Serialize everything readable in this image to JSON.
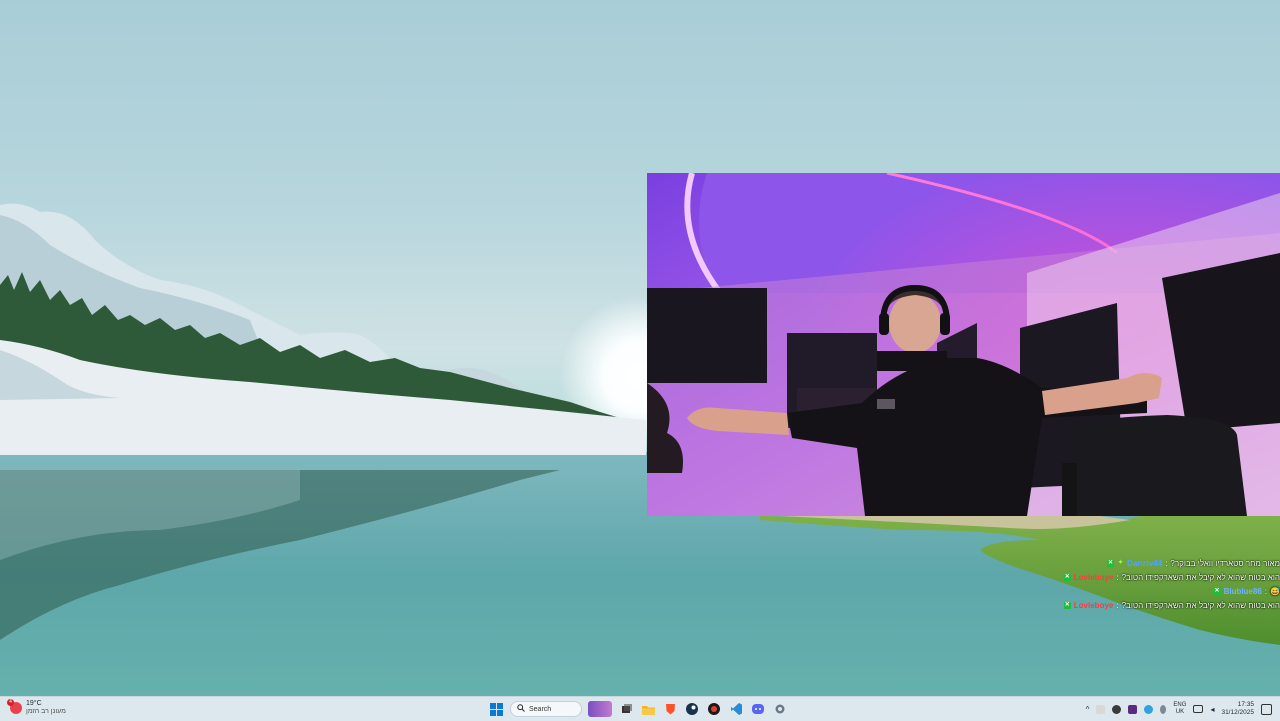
{
  "webcam": {
    "label": "Streamer webcam overlay"
  },
  "chat": {
    "messages": [
      {
        "user": "Danztv44",
        "user_color": "#4fa3ff",
        "text": "מאור מחר סטארדיו וואלי בבוקר?"
      },
      {
        "user": "Lovleboye",
        "user_color": "#ff3b3b",
        "text": "הוא בטוח שהוא לא קיבל את השארקפידו הטוב?"
      },
      {
        "user": "Blublue86",
        "user_color": "#6fb2ff",
        "text": "😅"
      },
      {
        "user": "Lovleboye",
        "user_color": "#ff3b3b",
        "text": "הוא בטוח שהוא לא קיבל את השארקפידו הטוב?"
      }
    ]
  },
  "taskbar": {
    "weather": {
      "temp": "19°C",
      "desc": "מעונן רב הזמן",
      "badge": "4"
    },
    "search": {
      "placeholder": "Search"
    },
    "pinned": [
      "start-icon",
      "search",
      "people-icon",
      "task-view-icon",
      "file-explorer-icon",
      "brave-icon",
      "steam-icon",
      "app-red-icon",
      "vscode-icon",
      "discord-icon",
      "settings-icon"
    ],
    "tray": {
      "lang_top": "ENG",
      "lang_bottom": "UK",
      "time": "17:35",
      "date": "31/12/2025"
    }
  },
  "colors": {
    "taskbar_bg": "#dde8ee",
    "accent": "#0067c0"
  }
}
